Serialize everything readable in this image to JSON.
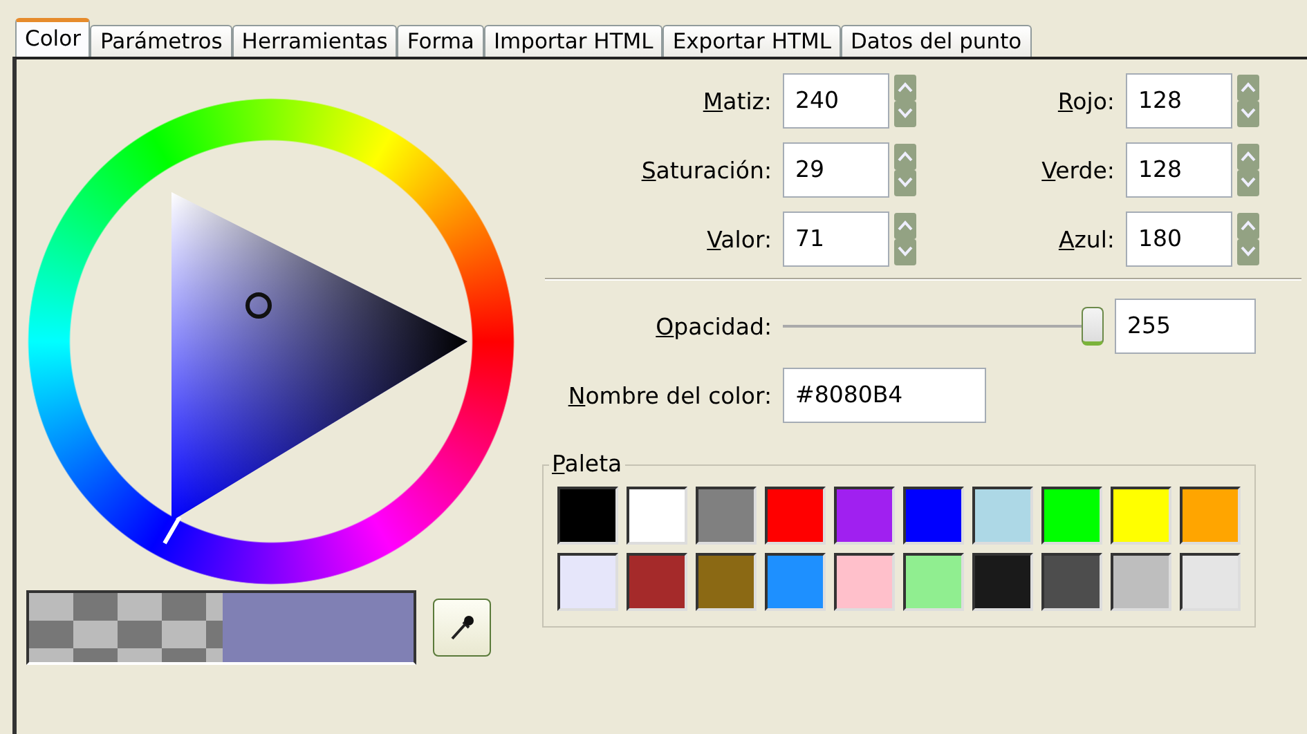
{
  "tabs": [
    {
      "label": "Color",
      "selected": true
    },
    {
      "label": "Parámetros",
      "selected": false
    },
    {
      "label": "Herramientas",
      "selected": false
    },
    {
      "label": "Forma",
      "selected": false
    },
    {
      "label": "Importar HTML",
      "selected": false
    },
    {
      "label": "Exportar HTML",
      "selected": false
    },
    {
      "label": "Datos del punto",
      "selected": false
    }
  ],
  "spin_rows": [
    [
      {
        "label": "Matiz:",
        "value": "240"
      },
      {
        "label": "Rojo:",
        "value": "128"
      }
    ],
    [
      {
        "label": "Saturación:",
        "value": "29"
      },
      {
        "label": "Verde:",
        "value": "128"
      }
    ],
    [
      {
        "label": "Valor:",
        "value": "71"
      },
      {
        "label": "Azul:",
        "value": "180"
      }
    ]
  ],
  "opacity": {
    "label": "Opacidad:",
    "level": 1,
    "value": "255"
  },
  "color_name": {
    "label": "Nombre del color:",
    "value": "#8080B4"
  },
  "preview": {
    "color": "#8080b4"
  },
  "palette": {
    "title": "Paleta",
    "swatches": [
      {
        "color": "#000000"
      },
      {
        "color": "#ffffff"
      },
      {
        "color": "#808080"
      },
      {
        "color": "#ff0000"
      },
      {
        "color": "#a020f0"
      },
      {
        "color": "#0000ff"
      },
      {
        "color": "#add8e6"
      },
      {
        "color": "#00ff00"
      },
      {
        "color": "#ffff00"
      },
      {
        "color": "#ffa500"
      },
      {
        "color": "#e6e6fa"
      },
      {
        "color": "#a52a2a"
      },
      {
        "color": "#8b6914"
      },
      {
        "color": "#1e90ff"
      },
      {
        "color": "#ffc0cb"
      },
      {
        "color": "#90ee90"
      },
      {
        "color": "#1a1a1a"
      },
      {
        "color": "#4d4d4d"
      },
      {
        "color": "#bebebe"
      },
      {
        "color": "#e5e5e5"
      }
    ]
  }
}
